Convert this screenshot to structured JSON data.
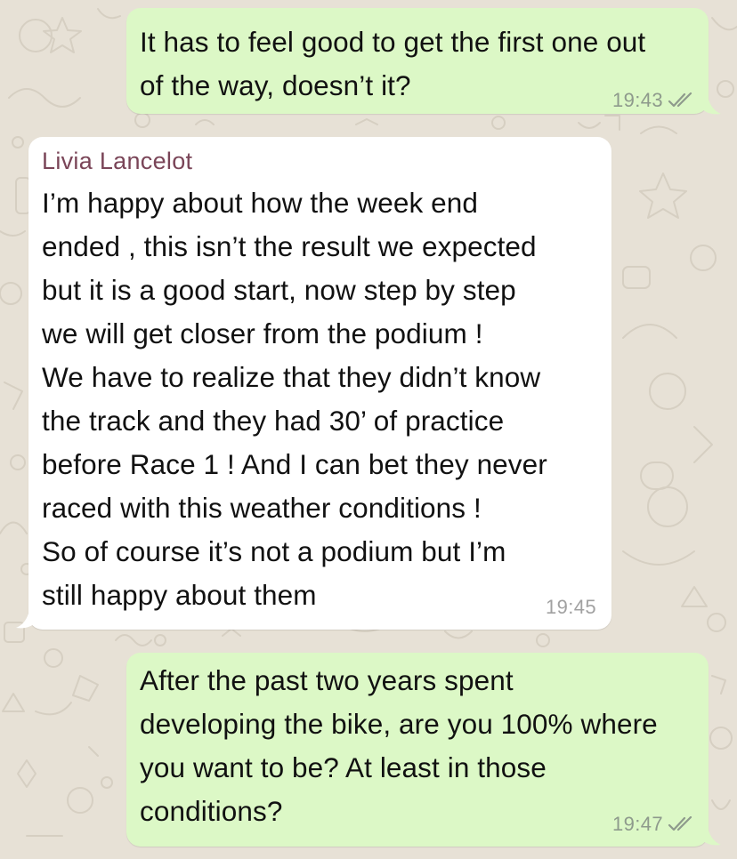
{
  "colors": {
    "outgoing_bubble": "#dcf8c6",
    "incoming_bubble": "#ffffff",
    "wallpaper": "#e7e1d6",
    "sender_name": "#7a4558",
    "read_ticks": "#8e9a8c"
  },
  "messages": [
    {
      "direction": "outgoing",
      "text": "It has to feel good to get the first one out\nof the way, doesn’t it?",
      "time": "19:43",
      "status_icon": "double-check-icon"
    },
    {
      "direction": "incoming",
      "sender": "Livia Lancelot",
      "text": "I’m happy about how the week end\nended , this isn’t the result we expected\nbut it is a good start, now step by step\nwe will get closer from the podium !\nWe have to realize that they didn’t know\nthe track and they had 30’ of practice\nbefore Race 1 ! And I can bet they never\nraced with this weather conditions !\nSo of course it’s not a podium but I’m\nstill happy about them",
      "time": "19:45"
    },
    {
      "direction": "outgoing",
      "text": "After the past two years spent\ndeveloping the bike, are you 100% where\nyou want to be? At least in those\nconditions?",
      "time": "19:47",
      "status_icon": "double-check-icon"
    }
  ]
}
